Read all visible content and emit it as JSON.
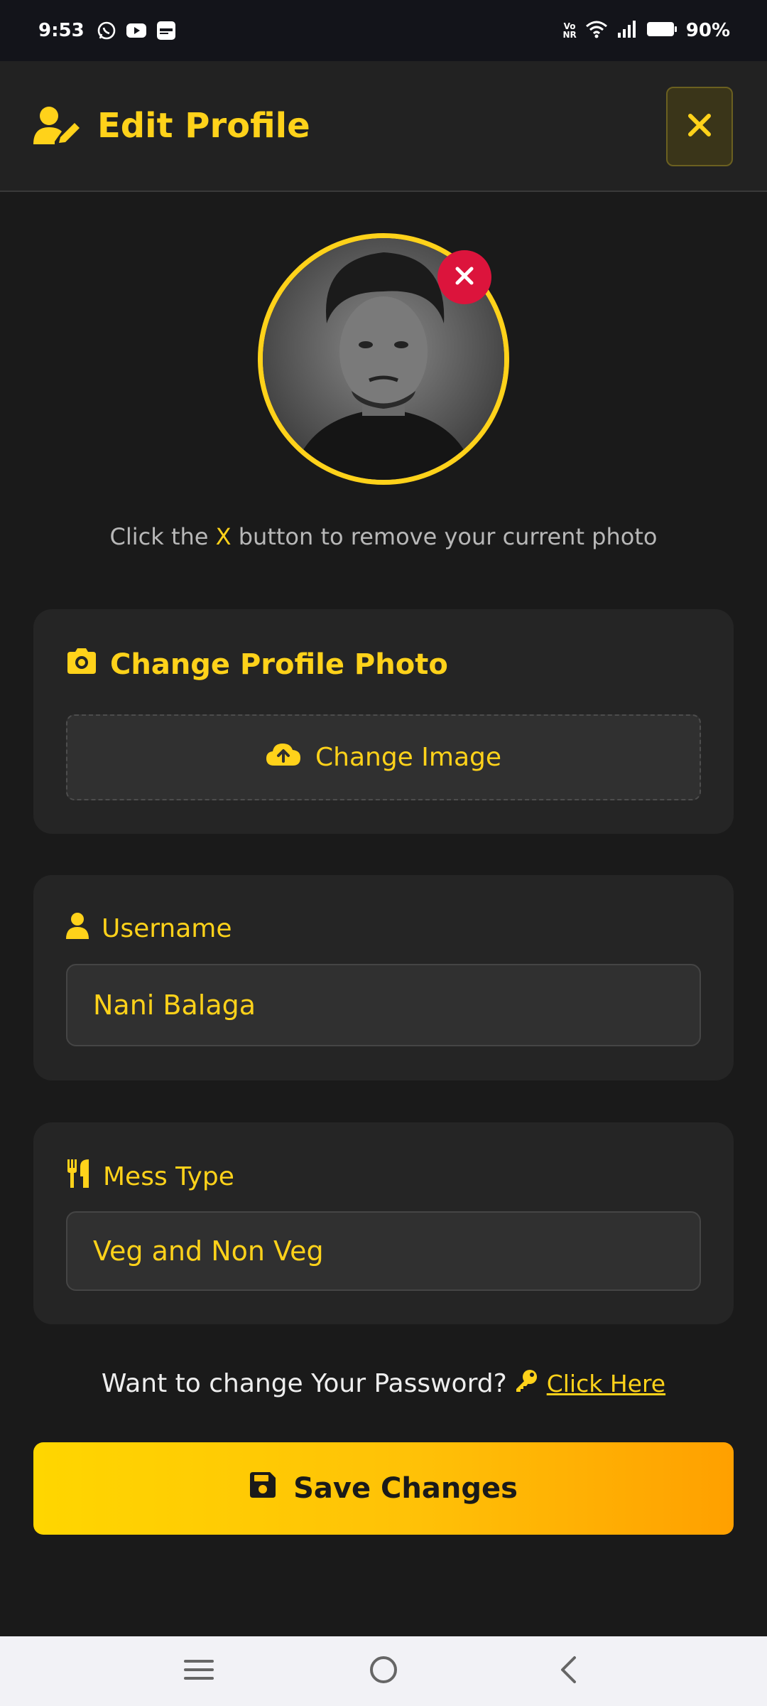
{
  "status_bar": {
    "time": "9:53",
    "volte": "Vo\nNR",
    "battery": "90%"
  },
  "header": {
    "title": "Edit Profile"
  },
  "profile": {
    "hint_prefix": "Click the ",
    "hint_highlight": "X",
    "hint_suffix": " button to remove your current photo"
  },
  "photo_card": {
    "title": "Change Profile Photo",
    "upload_label": "Change Image"
  },
  "username_card": {
    "label": "Username",
    "value": "Nani Balaga"
  },
  "mess_card": {
    "label": "Mess Type",
    "value": "Veg and Non Veg"
  },
  "password": {
    "prompt": "Want to change Your Password?",
    "link": "Click Here"
  },
  "save_button": {
    "label": "Save Changes"
  },
  "colors": {
    "accent": "#ffd21a",
    "background": "#1a1a1a",
    "card": "#252525",
    "danger": "#dc143c"
  },
  "icons": [
    "whatsapp-icon",
    "youtube-icon",
    "app-notification-icon",
    "wifi-icon",
    "signal-icon",
    "battery-icon",
    "user-edit-icon",
    "close-icon",
    "camera-icon",
    "cloud-upload-icon",
    "user-icon",
    "utensils-icon",
    "key-icon",
    "save-icon",
    "recents-icon",
    "home-icon",
    "back-icon"
  ]
}
